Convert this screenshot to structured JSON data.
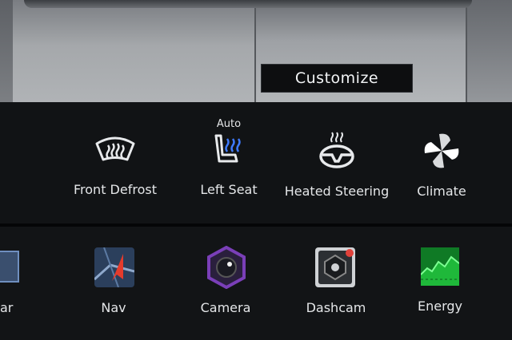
{
  "customize": {
    "label": "Customize"
  },
  "controls": [
    {
      "label": "Front Defrost",
      "icon": "front-defrost-icon"
    },
    {
      "label": "Left Seat",
      "sublabel": "Auto",
      "icon": "heated-seat-icon"
    },
    {
      "label": "Heated Steering",
      "icon": "heated-steering-icon"
    },
    {
      "label": "Climate",
      "icon": "fan-icon"
    }
  ],
  "apps": [
    {
      "label": "ar",
      "icon": "partial-app-icon"
    },
    {
      "label": "Nav",
      "icon": "navigation-icon"
    },
    {
      "label": "Camera",
      "icon": "camera-icon"
    },
    {
      "label": "Dashcam",
      "icon": "dashcam-icon"
    },
    {
      "label": "Energy",
      "icon": "energy-icon"
    }
  ],
  "colors": {
    "seat_heat_blue": "#3f7bff",
    "camera_purple": "#7a3fb8",
    "energy_green": "#1fb83a",
    "nav_red": "#e53b2c",
    "dashcam_red": "#e0413a"
  }
}
